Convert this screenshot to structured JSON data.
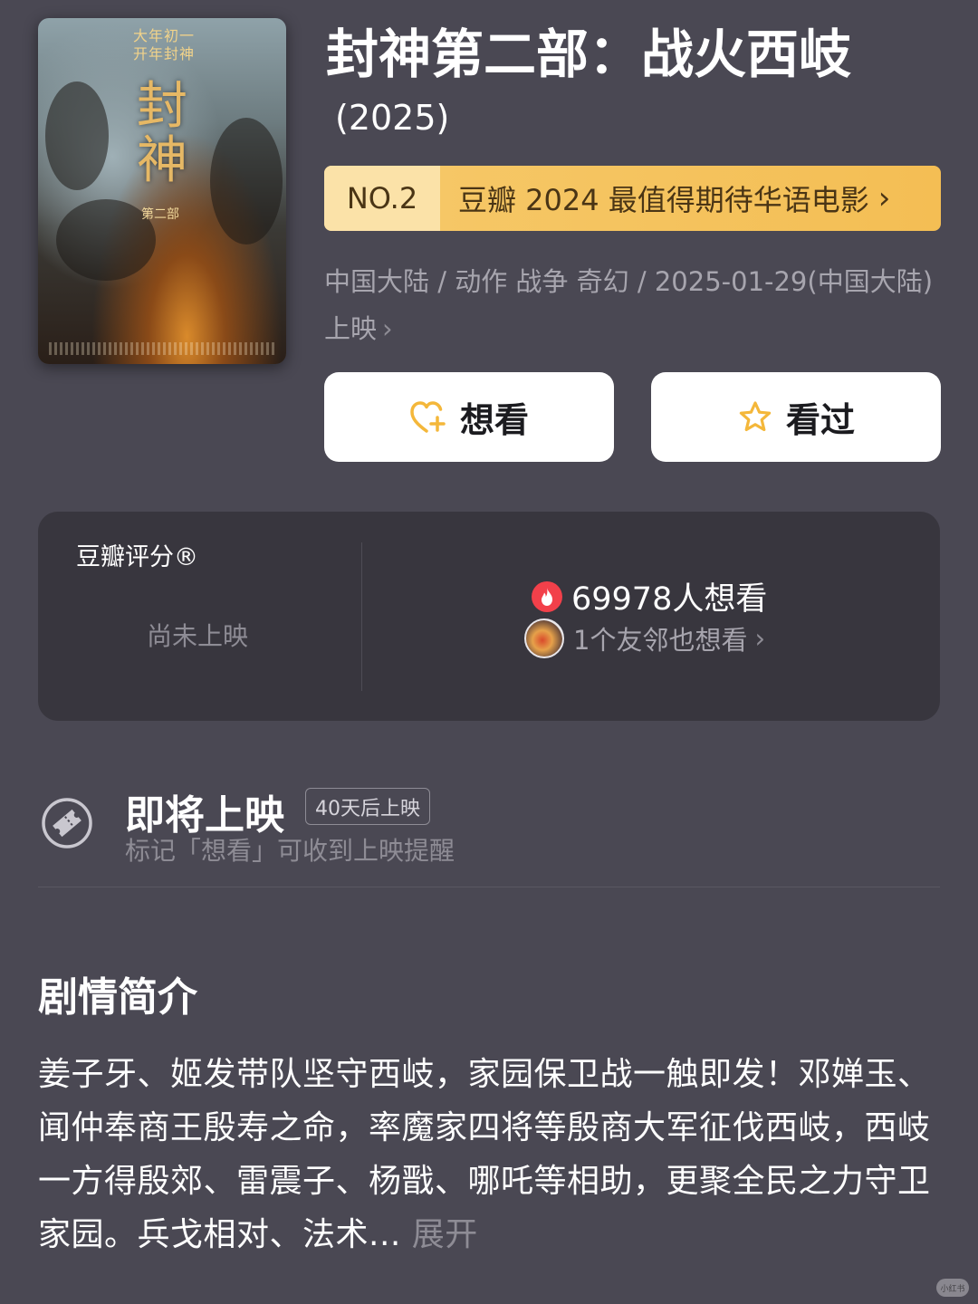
{
  "movie": {
    "title": "封神第二部：战火西岐",
    "year": "(2025)",
    "poster": {
      "tagline": "大年初一 开年封神",
      "title_char": "封神",
      "subtitle": "第二部"
    }
  },
  "ranking": {
    "no": "NO.2",
    "text": "豆瓣 2024 最值得期待华语电影",
    "chevron": "›"
  },
  "meta": {
    "text": "中国大陆 / 动作 战争 奇幻 / 2025-01-29(中国大陆) 上映",
    "chevron": "›"
  },
  "actions": {
    "want_label": "想看",
    "seen_label": "看过",
    "want_icon": "heart-plus-icon",
    "seen_icon": "star-outline-icon",
    "icon_color": "#f4b73a"
  },
  "rating": {
    "title": "豆瓣评分®",
    "status": "尚未上映",
    "wish_count": "69978人想看",
    "friends": "1个友邻也想看",
    "chevron": "›",
    "fire_color": "#f2404a"
  },
  "upcoming": {
    "title": "即将上映",
    "badge": "40天后上映",
    "hint": "标记「想看」可收到上映提醒",
    "icon": "ticket-icon"
  },
  "synopsis": {
    "heading": "剧情简介",
    "text": "姜子牙、姬发带队坚守西岐，家园保卫战一触即发！邓婵玉、闻仲奉商王殷寿之命，率魔家四将等殷商大军征伐西岐，西岐一方得殷郊、雷震子、杨戬、哪吒等相助，更聚全民之力守卫家园。兵戈相对、法术...",
    "expand": "展开"
  },
  "watermark": "小红书",
  "colors": {
    "background": "#4a4853",
    "card": "#38363e",
    "rank_gold": "#f4be54",
    "muted_text": "#a7a5ae"
  }
}
